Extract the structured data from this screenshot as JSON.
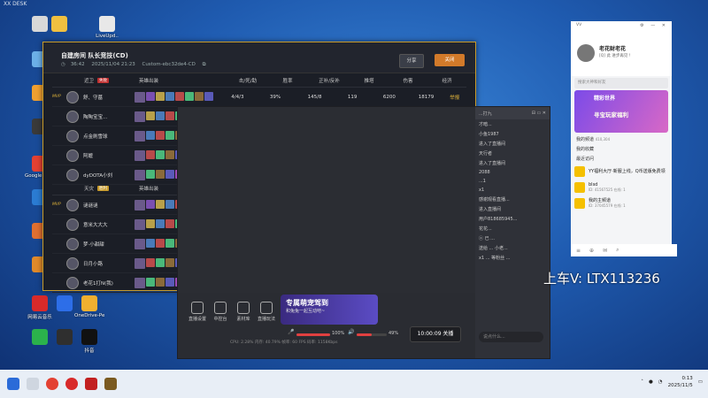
{
  "watermark": "XX\nDESK",
  "desktop_icons": [
    {
      "label": "",
      "color": "#d8d8d8"
    },
    {
      "label": "",
      "color": "#f0c040"
    },
    {
      "label": "LiveUpd..",
      "color": "#e8e8e8"
    },
    {
      "label": "",
      "color": "#6cb0e8"
    },
    {
      "label": "",
      "color": "#f0a030"
    },
    {
      "label": "",
      "color": "#3a3a3a"
    },
    {
      "label": "Google Chrome",
      "color": "#e34133"
    },
    {
      "label": "",
      "color": "#2b7cd3"
    },
    {
      "label": "",
      "color": "#e07030"
    },
    {
      "label": "",
      "color": "#e08a2a"
    },
    {
      "label": "网易云音乐",
      "color": "#d82a2a"
    },
    {
      "label": "",
      "color": "#2d6ee8"
    },
    {
      "label": "OneDrive-Pe...",
      "color": "#f0b030"
    },
    {
      "label": "",
      "color": "#2bb24c"
    },
    {
      "label": "",
      "color": "#2f2f2f"
    },
    {
      "label": "抖音",
      "color": "#111111"
    }
  ],
  "match": {
    "title": "自建房间 队长竞技(CD)",
    "duration": "36:42",
    "date": "2025/11/04 21:23",
    "room_id": "Custom-ebc32de4-CD",
    "share_label": "分享",
    "close_label": "关闭",
    "columns": [
      "英雄出装",
      "击/死/助",
      "胜率",
      "正补/反补",
      "推塔",
      "伤害",
      "经济"
    ],
    "radiant": {
      "name": "近卫",
      "result": "失败",
      "result_color": "#c03030",
      "players": [
        {
          "badge": "MVP",
          "name": "舒、守墓",
          "kda": "4/4/3",
          "win": "39%",
          "cs": "145/8",
          "tower": "119",
          "damage": "6200",
          "econ": "18179",
          "report": "举报"
        },
        {
          "badge": "",
          "name": "陶陶宝宝...",
          "kda": "3/4/4",
          "win": "38%",
          "cs": "139/6",
          "tower": "892",
          "damage": "12944",
          "econ": "13211",
          "report": "举报"
        },
        {
          "badge": "",
          "name": "点金刷雪球",
          "kda": "4/4/4",
          "win": "39%",
          "cs": "93/11",
          "tower": "0",
          "damage": "15638",
          "econ": "9959",
          "report": "举报"
        },
        {
          "badge": "",
          "name": "阿嬷",
          "kda": "3/8/7",
          "win": "56%",
          "cs": "3/0",
          "tower": "0",
          "damage": "4013",
          "econ": "5534",
          "report": "举报"
        },
        {
          "badge": "",
          "name": "dyDOTA小刘",
          "kda": "1/7/7",
          "win": "44%",
          "cs": "9/2",
          "tower": "0",
          "damage": "6023",
          "econ": "5044",
          "report": "举报"
        }
      ]
    },
    "dire": {
      "name": "天灾",
      "result": "胜利",
      "result_color": "#c79a2a",
      "players": [
        {
          "badge": "MVP",
          "name": "谜谜谜",
          "kda": "3/1/13",
          "win": "53%",
          "cs": "71/10",
          "tower": "4897",
          "damage": "10798",
          "econ": "16765",
          "report": "举报"
        },
        {
          "badge": "",
          "name": "意米大大大",
          "kda": "6/3/5",
          "win": "37%",
          "cs": "148/21",
          "tower": "1285",
          "damage": "6366",
          "econ": "17695",
          "report": "举报"
        },
        {
          "badge": "",
          "name": "梦·小甜甜",
          "kda": "9/3/8",
          "win": "47%",
          "cs": "138/22",
          "tower": "3191",
          "damage": "8954",
          "econ": "15965",
          "report": "举报"
        },
        {
          "badge": "",
          "name": "日月小路",
          "kda": "13/4/7",
          "win": "67%",
          "cs": "64/8",
          "tower": "261",
          "damage": "12412",
          "econ": "12874",
          "report": "举报"
        },
        {
          "badge": "",
          "name": "老花1打N(我)",
          "kda": "1/7/10",
          "win": "37%",
          "cs": "28/1",
          "tower": "970",
          "damage": "4976",
          "econ": "7791",
          "report": "举报"
        }
      ]
    }
  },
  "stream": {
    "title_fragment": "...打九",
    "tools": [
      "直播设置",
      "中控台",
      "素材库",
      "直播玩法"
    ],
    "promo_title": "专属萌宠驾到",
    "promo_sub": "和兔兔一起互动吧~",
    "mic_pct": "100%",
    "vol_pct": "49%",
    "mic_fill": 1.0,
    "vol_fill": 0.49,
    "timer": "10:00:09 关播",
    "status": "CPU: 2.28%    内存: 40.79%    帧率: 60 FPS    码率: 1158Kbps",
    "chat": [
      "才暗...",
      "小鱼1987",
      "进入了直播间",
      "天行者",
      "进入了直播间",
      "2088",
      "...1",
      "x1",
      "感谢观看直播...",
      "进入直播间",
      "用户818685945...",
      "花花...",
      "ⓧ 已 ...",
      "送给 ... 小老...",
      "x1 ... 等粉丝 ..."
    ],
    "chat_placeholder": "说点什么..."
  },
  "qq": {
    "title": "VV",
    "name": "老花财老花",
    "signature": "[Q] 此 进步再见 !",
    "search_placeholder": "搜索大神和好友",
    "banner_top": "精彩世界",
    "banner_main": "寻宝玩家福利",
    "section1": "我的频道",
    "section1_count": "410,304",
    "section2": "我的收藏",
    "section3": "最近访问",
    "items": [
      {
        "title": "YY福利大厅·新服上线，Q币送版免费领",
        "sub": ""
      },
      {
        "title": "blsd",
        "sub": "ID: 41567525  在线: 1"
      },
      {
        "title": "我的主频道",
        "sub": "ID: 37045579  在线: 1"
      }
    ]
  },
  "overlay_text": "上车V:  LTX113236",
  "taskbar": {
    "time": "0:13",
    "date": "2025/11/5"
  }
}
